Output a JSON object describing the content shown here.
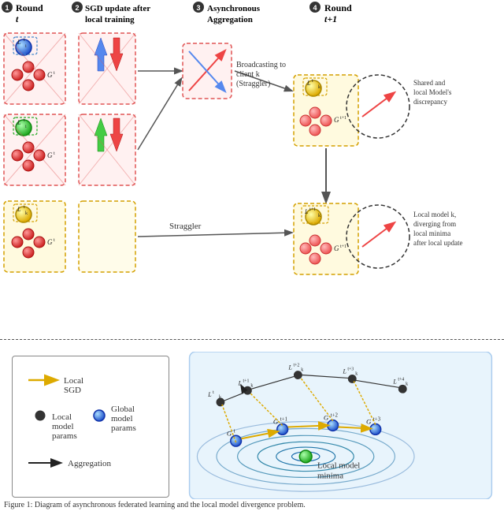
{
  "steps": [
    {
      "num": "1",
      "label": "Round t"
    },
    {
      "num": "2",
      "label": "SGD update after local training"
    },
    {
      "num": "3",
      "label": "Asynchronous Aggregation"
    },
    {
      "num": "4",
      "label": "Round t+1"
    }
  ],
  "arrows": {
    "broadcasting": "Broadcasting to client k (Straggler)",
    "straggler": "Straggler"
  },
  "annotations": {
    "shared_local": "Shared and local Model's discrepancy",
    "local_model_diverging": "Local model k, diverging from local minima after local update"
  },
  "legend": {
    "local_sgd": "Local SGD",
    "local_model": "Local model params",
    "global_model": "Global model params",
    "aggregation": "Aggregation"
  },
  "contour": {
    "label": "Local model minima"
  },
  "caption": "Figure 1: Diagram of asynchronous federated learning and the local model divergence problem."
}
